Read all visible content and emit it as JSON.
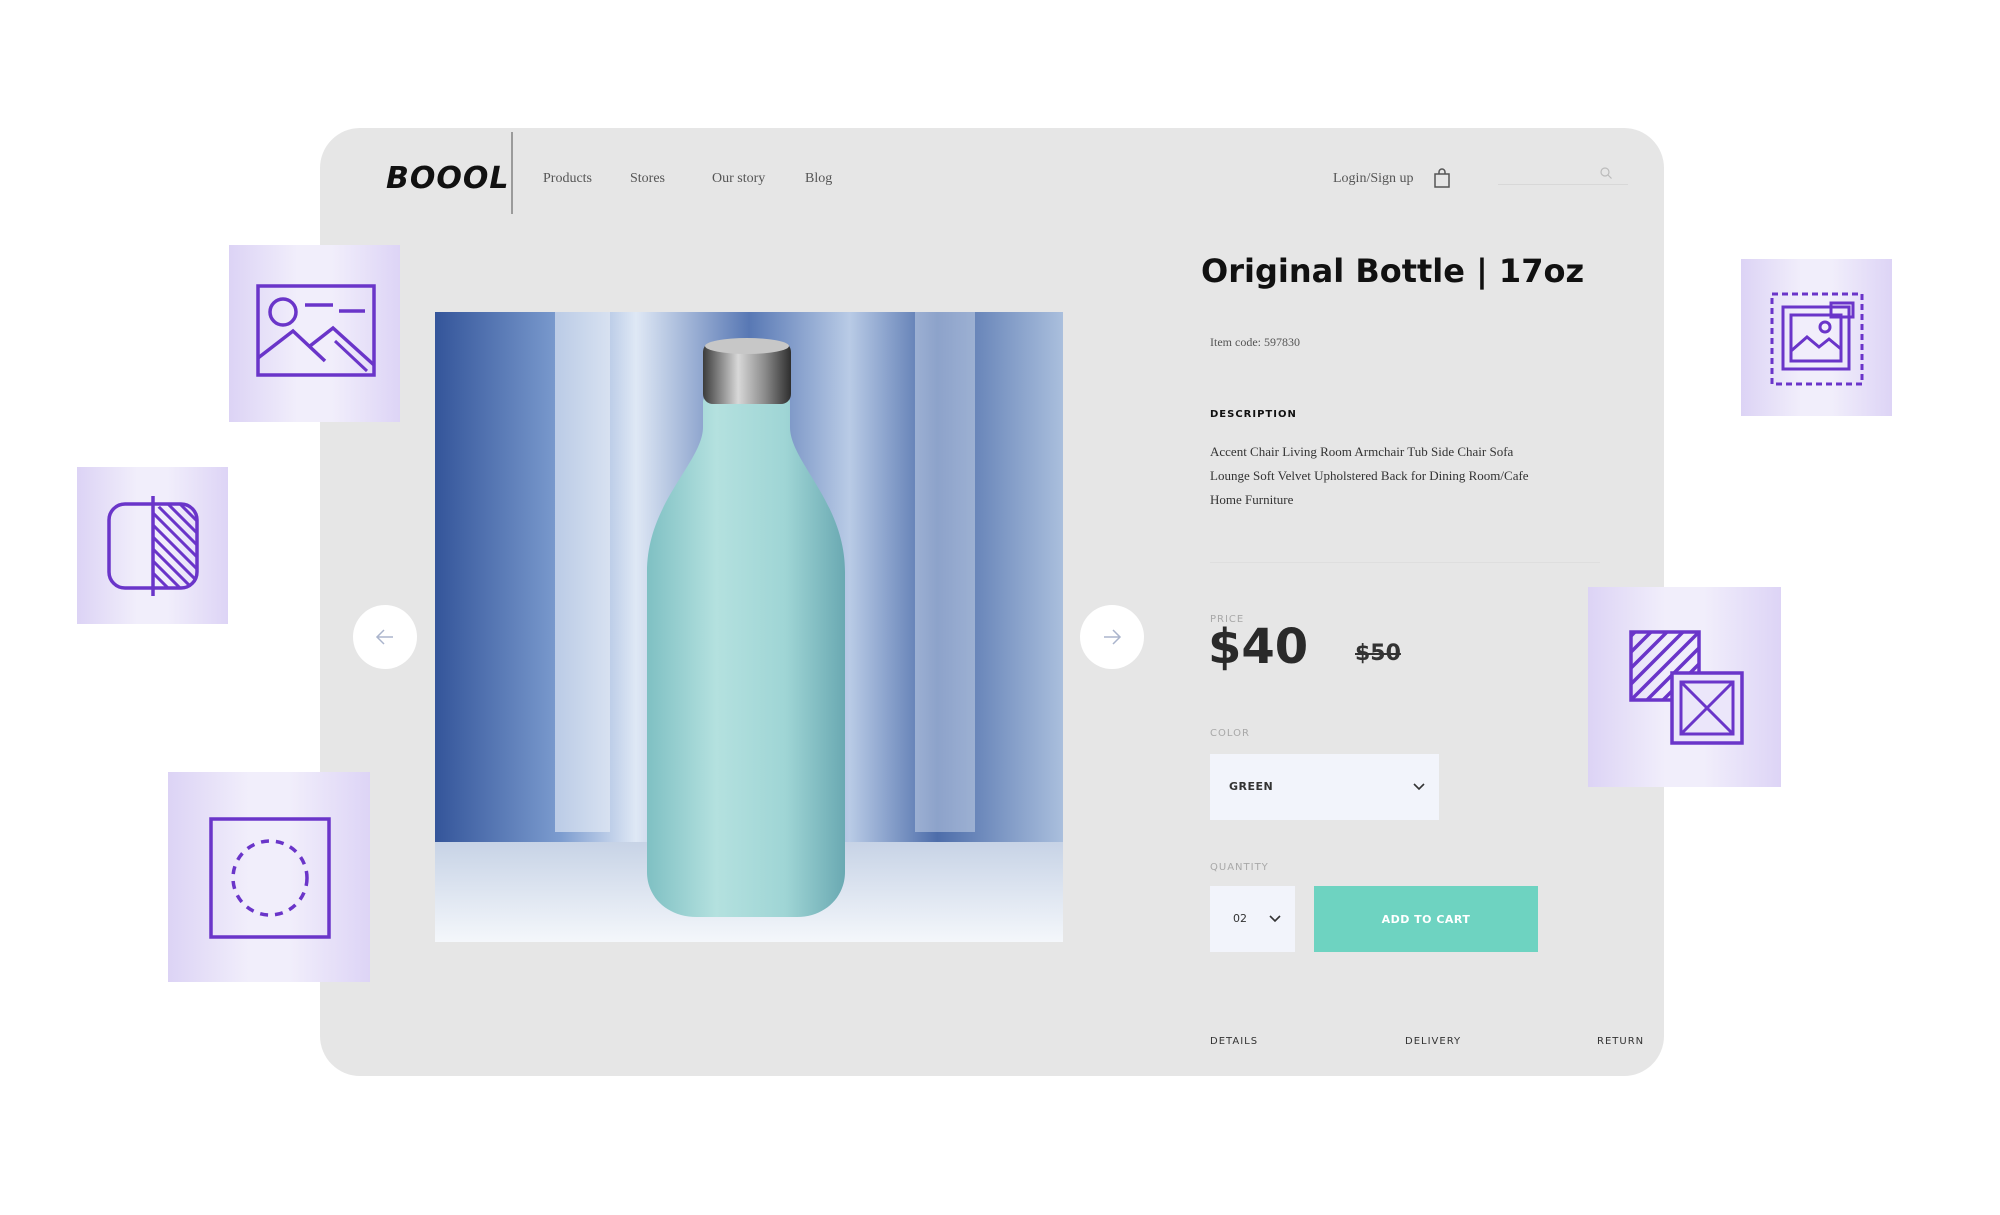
{
  "brand": {
    "logo": "BOOOL"
  },
  "nav": {
    "links": [
      "Products",
      "Stores",
      "Our story",
      "Blog"
    ],
    "login_label": "Login/Sign up",
    "cart_icon": "shopping-bag-icon",
    "search_icon": "search-icon"
  },
  "gallery": {
    "prev_icon": "arrow-left-icon",
    "next_icon": "arrow-right-icon"
  },
  "product": {
    "title": "Original Bottle | 17oz",
    "item_code": "Item code: 597830",
    "description_heading": "DESCRIPTION",
    "description": "Accent Chair Living Room Armchair Tub Side Chair Sofa Lounge Soft Velvet Upholstered Back for Dining Room/Cafe Home Furniture",
    "price_label": "PRICE",
    "price": "$40",
    "old_price": "$50",
    "color_label": "COLOR",
    "color_value": "GREEN",
    "quantity_label": "QUANTITY",
    "quantity_value": "02",
    "add_to_cart_label": "ADD TO CART"
  },
  "tabs": [
    "DETAILS",
    "DELIVERY",
    "RETURN"
  ],
  "colors": {
    "card_bg": "#e6e6e6",
    "accent": "#6ed3c1",
    "icon_purple": "#6a35c9",
    "tile_bg": "#ece7fb"
  },
  "decor_icons": [
    "image-icon",
    "contrast-icon",
    "dashed-circle-icon",
    "framed-image-icon",
    "overlap-squares-icon"
  ]
}
